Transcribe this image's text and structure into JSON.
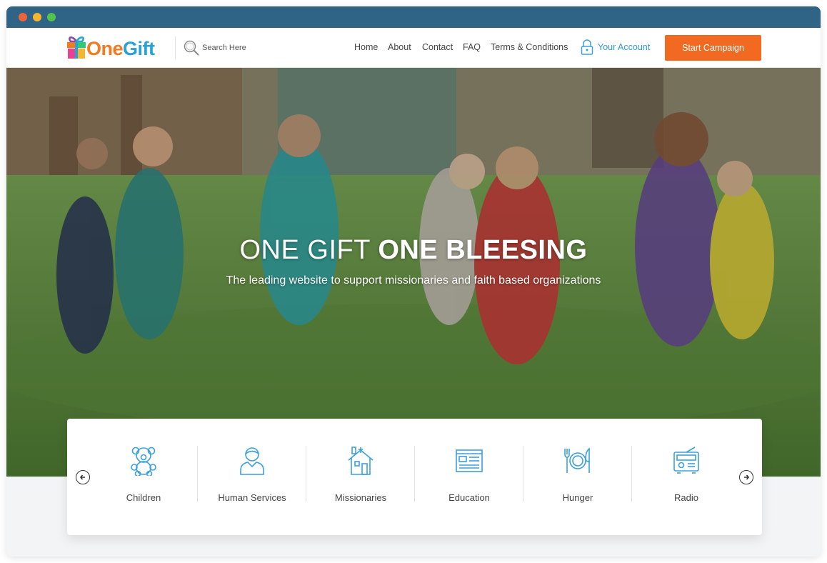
{
  "brand": {
    "logo_text_primary": "One",
    "logo_text_secondary": "Gift"
  },
  "search": {
    "placeholder": "Search Here"
  },
  "nav": {
    "items": [
      "Home",
      "About",
      "Contact",
      "FAQ",
      "Terms & Conditions"
    ],
    "account_label": "Your Account",
    "cta_label": "Start Campaign"
  },
  "hero": {
    "title_light": "ONE GIFT",
    "title_bold": "ONE BLEESING",
    "subtitle": "The leading website to support missionaries and faith based organizations"
  },
  "categories": [
    {
      "label": "Children",
      "icon": "teddy-bear-icon"
    },
    {
      "label": "Human Services",
      "icon": "person-icon"
    },
    {
      "label": "Missionaries",
      "icon": "house-icon"
    },
    {
      "label": "Education",
      "icon": "document-icon"
    },
    {
      "label": "Hunger",
      "icon": "plate-cutlery-icon"
    },
    {
      "label": "Radio",
      "icon": "radio-icon"
    }
  ],
  "colors": {
    "titlebar": "#2f6487",
    "accent_orange": "#f26a22",
    "accent_blue": "#2e9ad6",
    "icon_blue": "#3aa0e0"
  }
}
